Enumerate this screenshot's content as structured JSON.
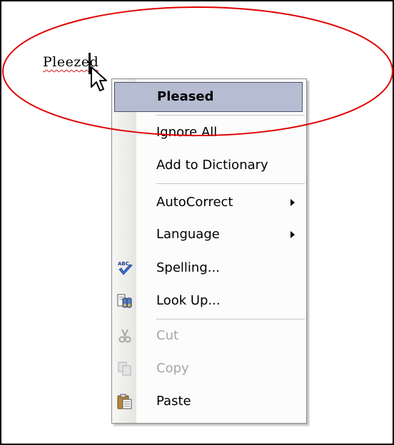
{
  "document": {
    "misspelled_word": "Pleezed"
  },
  "context_menu": {
    "suggestion": "Pleased",
    "items": [
      {
        "label": "Ignore All",
        "disabled": false
      },
      {
        "label": "Add to Dictionary",
        "disabled": false
      },
      {
        "label": "AutoCorrect",
        "disabled": false,
        "submenu": true
      },
      {
        "label": "Language",
        "disabled": false,
        "submenu": true
      },
      {
        "label": "Spelling...",
        "disabled": false,
        "icon": "spelling-abc-check-icon"
      },
      {
        "label": "Look Up...",
        "disabled": false,
        "icon": "research-binoculars-icon"
      },
      {
        "label": "Cut",
        "disabled": true,
        "icon": "scissors-icon"
      },
      {
        "label": "Copy",
        "disabled": true,
        "icon": "copy-icon"
      },
      {
        "label": "Paste",
        "disabled": false,
        "icon": "paste-clipboard-icon"
      }
    ]
  },
  "colors": {
    "highlight": "#b6bdd2",
    "annotation": "#e00000",
    "squiggle": "#d21a1a"
  }
}
